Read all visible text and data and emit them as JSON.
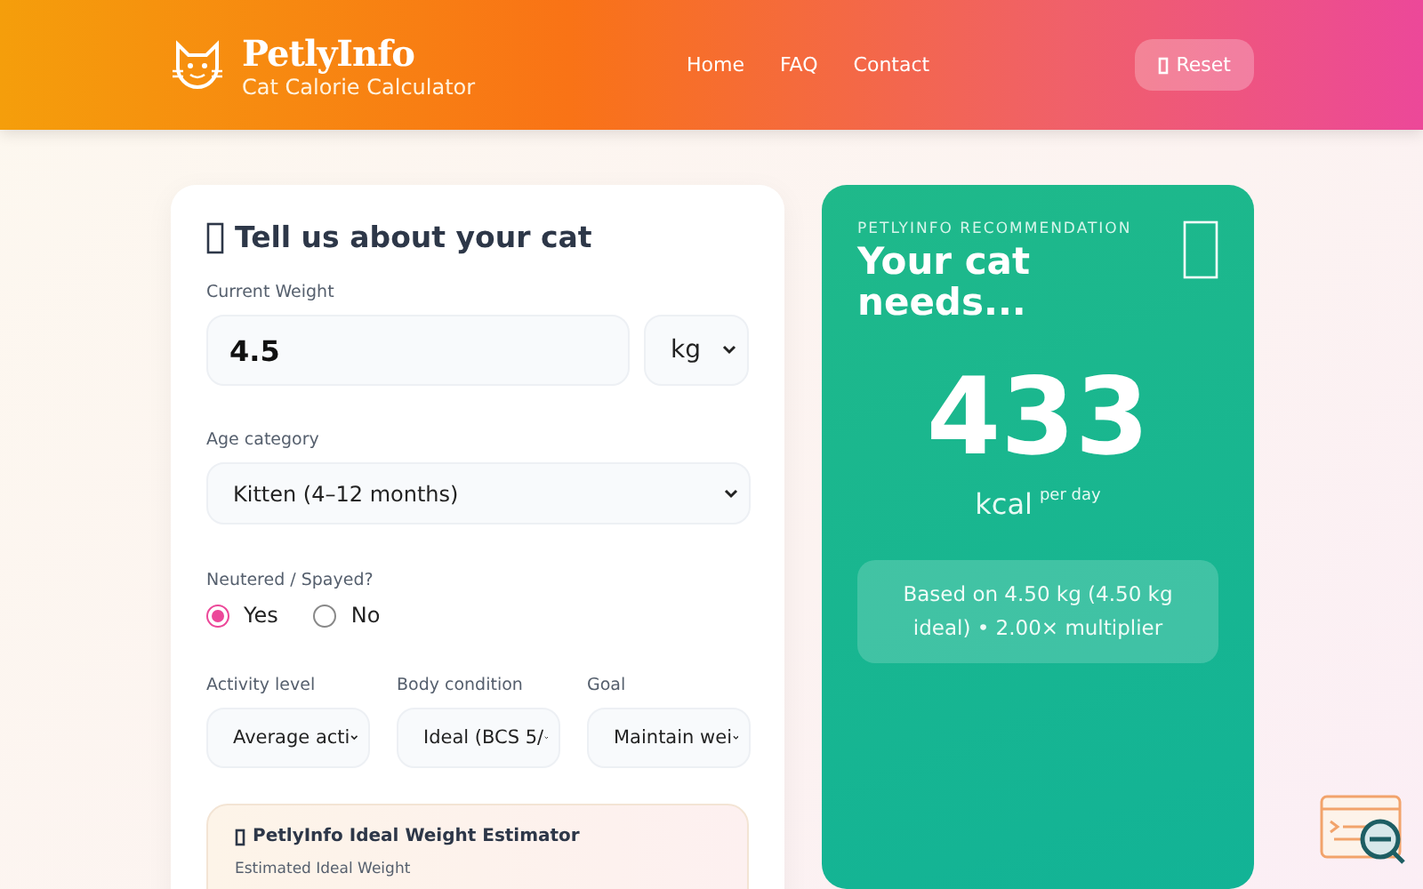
{
  "header": {
    "brand": "PetlyInfo",
    "subtitle": "Cat Calorie Calculator",
    "nav": [
      {
        "label": "Home"
      },
      {
        "label": "FAQ"
      },
      {
        "label": "Contact"
      }
    ],
    "reset_button": {
      "label": "Reset"
    }
  },
  "form": {
    "title": "Tell us about your cat",
    "weight": {
      "label": "Current Weight",
      "value": "4.5",
      "unit": "kg"
    },
    "age": {
      "label": "Age category",
      "value": "Kitten (4–12 months)"
    },
    "neutered": {
      "label": "Neutered / Spayed?",
      "options": [
        {
          "label": "Yes",
          "selected": true
        },
        {
          "label": "No",
          "selected": false
        }
      ]
    },
    "selects": [
      {
        "label": "Activity level",
        "value": "Average acti"
      },
      {
        "label": "Body condition",
        "value": "Ideal (BCS 5/"
      },
      {
        "label": "Goal",
        "value": "Maintain wei"
      }
    ],
    "estimator": {
      "title": "PetlyInfo Ideal Weight Estimator",
      "label": "Estimated Ideal Weight"
    }
  },
  "result": {
    "eyebrow": "PETLYINFO RECOMMENDATION",
    "title": "Your cat needs...",
    "value": "433",
    "unit": "kcal",
    "period": "per day",
    "note": "Based on 4.50 kg (4.50 kg ideal) • 2.00× multiplier"
  }
}
